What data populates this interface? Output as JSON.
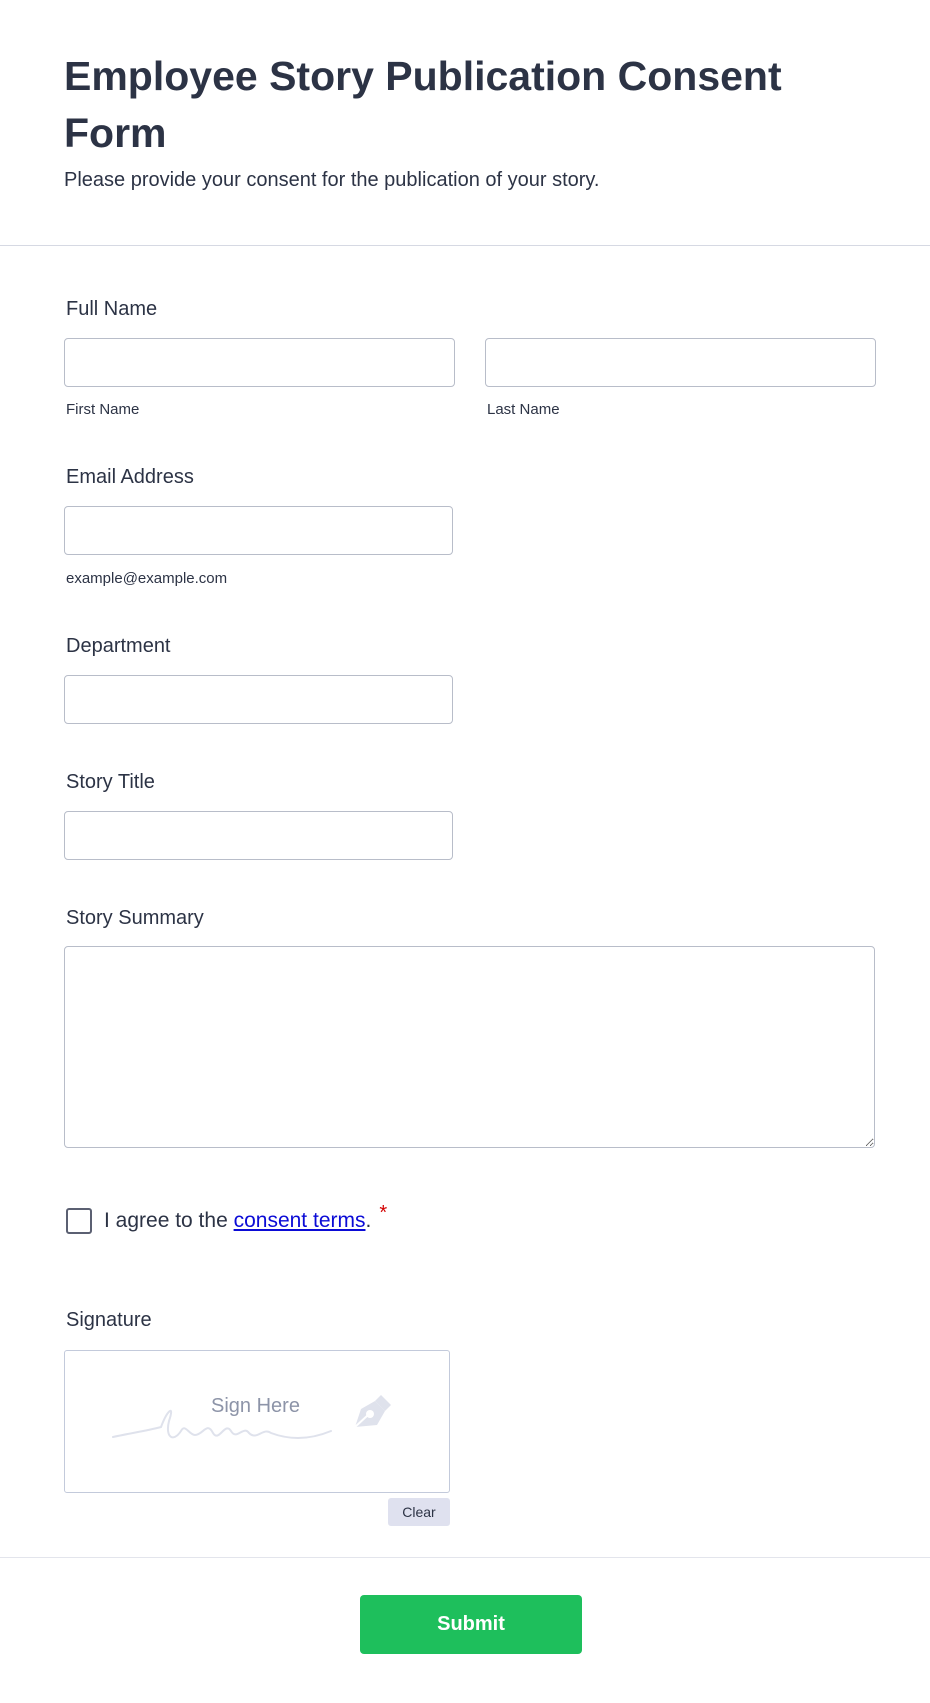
{
  "header": {
    "title": "Employee Story Publication Consent Form",
    "subtitle": "Please provide your consent for the publication of your story."
  },
  "full_name": {
    "label": "Full Name",
    "first_sublabel": "First Name",
    "last_sublabel": "Last Name",
    "first_value": "",
    "last_value": ""
  },
  "email": {
    "label": "Email Address",
    "sublabel": "example@example.com",
    "value": ""
  },
  "department": {
    "label": "Department",
    "value": ""
  },
  "story_title": {
    "label": "Story Title",
    "value": ""
  },
  "story_summary": {
    "label": "Story Summary",
    "value": ""
  },
  "consent": {
    "prefix": "I agree to the ",
    "link_text": "consent terms",
    "suffix": ".",
    "required_mark": "*",
    "checked": false
  },
  "signature": {
    "label": "Signature",
    "placeholder": "Sign Here",
    "clear_label": "Clear",
    "pen_icon": "pen-nib-icon"
  },
  "footer": {
    "submit_label": "Submit"
  },
  "colors": {
    "text": "#2c3345",
    "link": "#0b0bd6",
    "required": "#d30000",
    "submit": "#1ebf5c",
    "input_border": "#b8bdc9"
  }
}
